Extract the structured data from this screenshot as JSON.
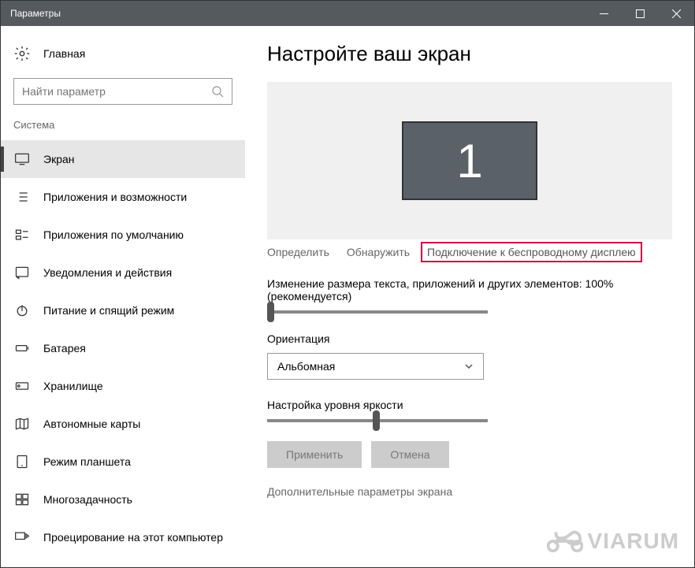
{
  "window": {
    "title": "Параметры"
  },
  "sidebar": {
    "home": "Главная",
    "search_placeholder": "Найти параметр",
    "category": "Система",
    "items": [
      {
        "label": "Экран"
      },
      {
        "label": "Приложения и возможности"
      },
      {
        "label": "Приложения по умолчанию"
      },
      {
        "label": "Уведомления и действия"
      },
      {
        "label": "Питание и спящий режим"
      },
      {
        "label": "Батарея"
      },
      {
        "label": "Хранилище"
      },
      {
        "label": "Автономные карты"
      },
      {
        "label": "Режим планшета"
      },
      {
        "label": "Многозадачность"
      },
      {
        "label": "Проецирование на этот компьютер"
      }
    ]
  },
  "main": {
    "heading": "Настройте ваш экран",
    "monitor_number": "1",
    "links": {
      "identify": "Определить",
      "detect": "Обнаружить",
      "wireless": "Подключение к беспроводному дисплею"
    },
    "scale_label": "Изменение размера текста, приложений и других элементов: 100% (рекомендуется)",
    "orientation_label": "Ориентация",
    "orientation_value": "Альбомная",
    "brightness_label": "Настройка уровня яркости",
    "apply_btn": "Применить",
    "cancel_btn": "Отмена",
    "advanced": "Дополнительные параметры экрана"
  },
  "watermark": "VIARUM"
}
